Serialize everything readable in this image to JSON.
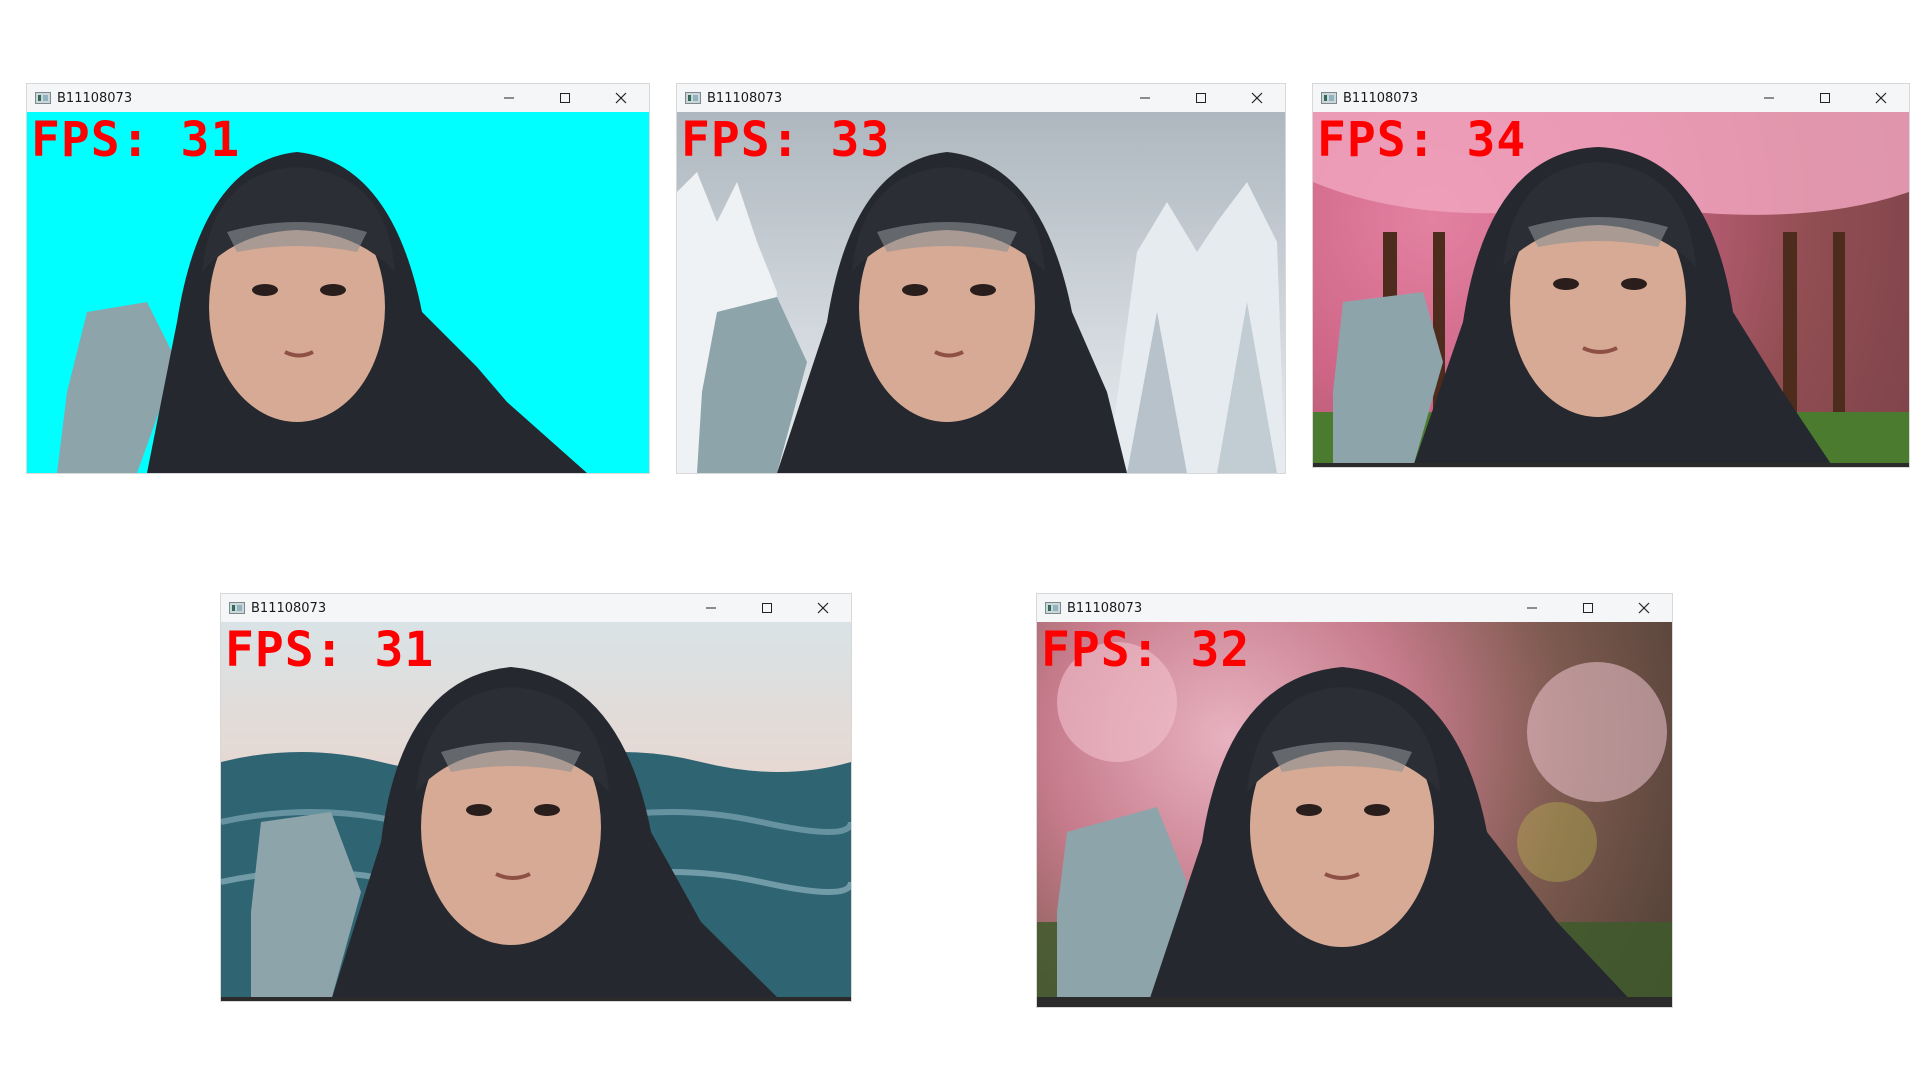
{
  "windows": [
    {
      "title": "B11108073",
      "fps_text": "FPS: 31",
      "background": "cyan"
    },
    {
      "title": "B11108073",
      "fps_text": "FPS: 33",
      "background": "snow-forest"
    },
    {
      "title": "B11108073",
      "fps_text": "FPS: 34",
      "background": "cherry-blossom-trees"
    },
    {
      "title": "B11108073",
      "fps_text": "FPS: 31",
      "background": "ocean-waves"
    },
    {
      "title": "B11108073",
      "fps_text": "FPS: 32",
      "background": "blurred-blossoms"
    }
  ],
  "icons": {
    "app": "app-icon",
    "minimize": "minimize-icon",
    "maximize": "maximize-icon",
    "close": "close-icon"
  },
  "colors": {
    "fps_text": "#ff0000",
    "cyan_bg": "#00ffff",
    "titlebar": "#f5f6f8"
  }
}
